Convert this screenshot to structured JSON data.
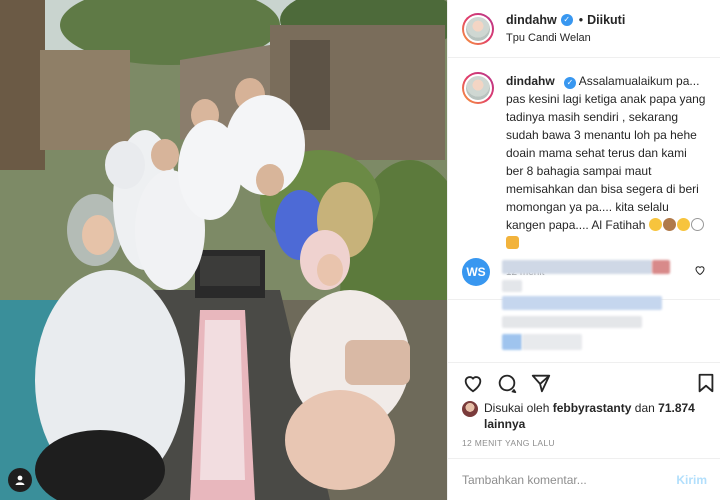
{
  "header": {
    "username": "dindahw",
    "follow_label": "Diikuti",
    "location": "Tpu Candi Welan"
  },
  "caption": {
    "username": "dindahw",
    "text": "Assalamualaikum pa... pas kesini lagi ketiga anak papa yang tadinya masih sendiri , sekarang sudah bawa 3 menantu loh pa hehe doain mama sehat terus dan kami ber 8 bahagia sampai maut memisahkan dan bisa segera di beri momongan ya pa.... kita selalu kangen papa.... Al Fatihah",
    "time": "12 menit"
  },
  "comment": {
    "avatar_initials": "WS"
  },
  "likes": {
    "prefix": "Disukai oleh",
    "user": "febbyrastanty",
    "connector": "dan",
    "count": "71.874 lainnya"
  },
  "time_ago": "12 MENIT YANG LALU",
  "comment_box": {
    "placeholder": "Tambahkan komentar...",
    "post_label": "Kirim"
  },
  "icons": {
    "verified": "verified-badge-icon",
    "like": "heart-icon",
    "comment": "comment-bubble-icon",
    "share": "paper-plane-icon",
    "save": "bookmark-icon",
    "tag": "user-tag-icon"
  },
  "colors": {
    "accent": "#3897f0",
    "text": "#262626",
    "muted": "#8e8e8e",
    "border": "#efefef",
    "post_disabled": "#b2dffc"
  }
}
